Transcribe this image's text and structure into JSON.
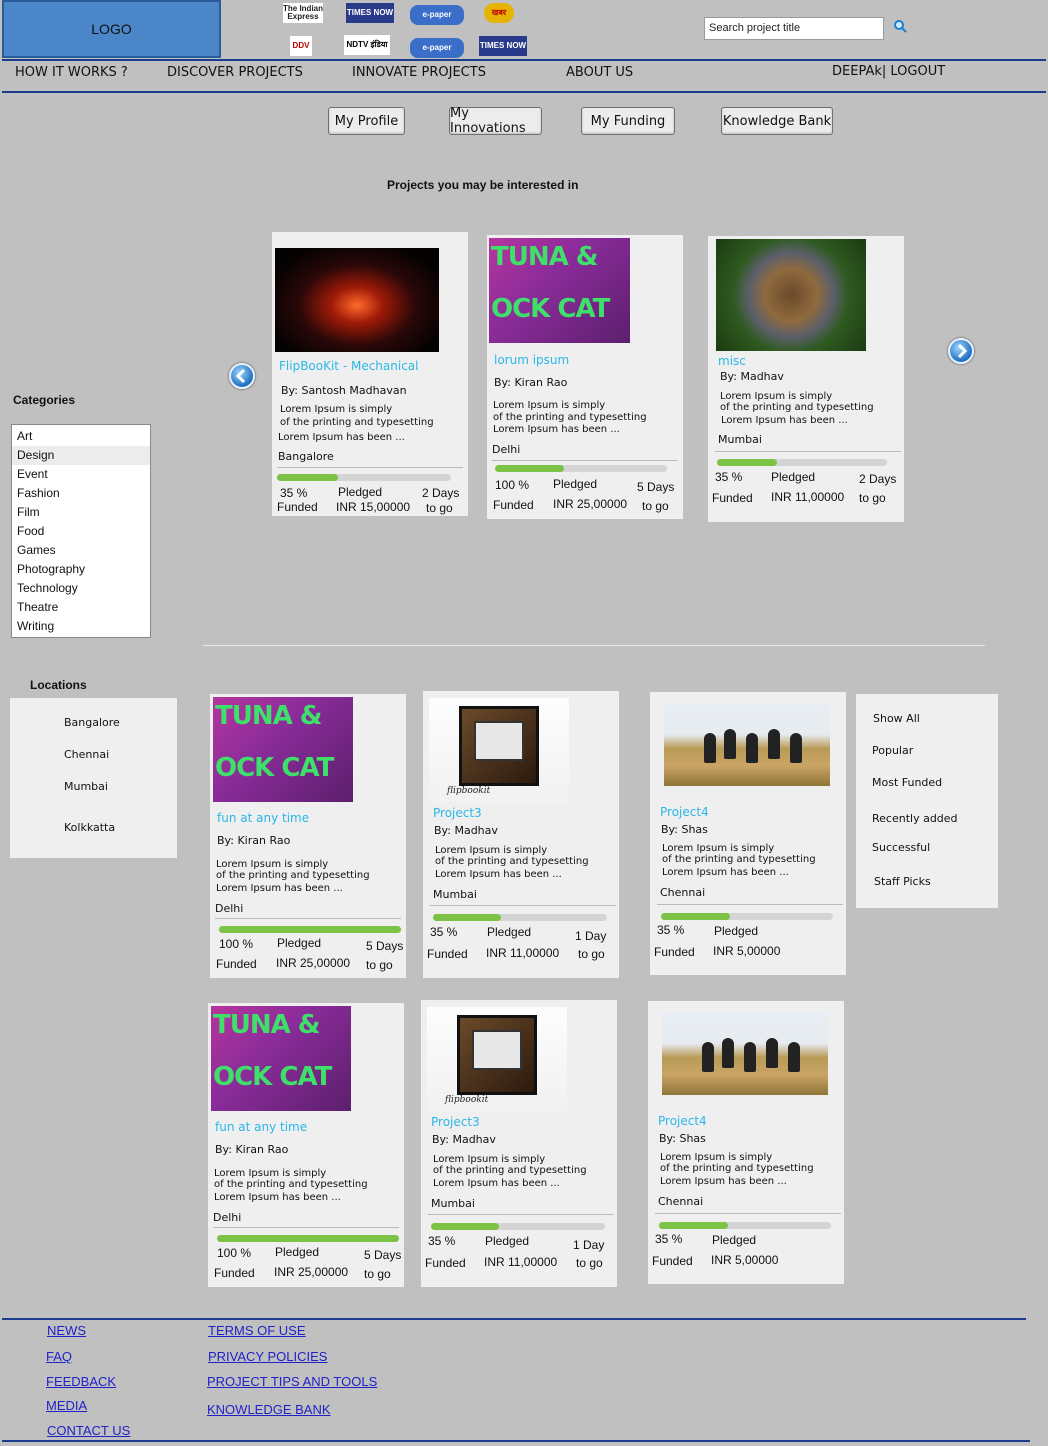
{
  "header": {
    "logo": "LOGO",
    "media_logos": [
      {
        "name": "newspaper-logo",
        "text": "The Indian Express",
        "bg": "#ffffff",
        "fg": "#222222"
      },
      {
        "name": "times-now-logo",
        "text": "TIMES NOW",
        "bg": "#2a3a8a",
        "fg": "#ffffff"
      },
      {
        "name": "epaper-logo",
        "text": "e-paper",
        "bg": "#3a6ec8",
        "fg": "#ffffff"
      },
      {
        "name": "tv-logo",
        "text": "खबर",
        "bg": "#e5b400",
        "fg": "#c00000"
      },
      {
        "name": "ddv-logo",
        "text": "DDV",
        "bg": "#ffffff",
        "fg": "#c00000"
      },
      {
        "name": "ndtv-india-logo",
        "text": "NDTV इंडिया",
        "bg": "#ffffff",
        "fg": "#000000"
      },
      {
        "name": "epaper-logo-2",
        "text": "e-paper",
        "bg": "#3a6ec8",
        "fg": "#ffffff"
      },
      {
        "name": "times-now-logo-2",
        "text": "TIMES NOW",
        "bg": "#2a3a8a",
        "fg": "#ffffff"
      }
    ],
    "search_placeholder": "Search project title"
  },
  "nav": {
    "how_it_works": "HOW IT WORKS ?",
    "discover": "DISCOVER PROJECTS",
    "innovate": "INNOVATE PROJECTS",
    "about": "ABOUT US",
    "user": "DEEPAk| LOGOUT"
  },
  "tabs": [
    "My Profile",
    "My Innovations",
    "My Funding",
    "Knowledge Bank"
  ],
  "section_title": "Projects you may be interested in",
  "categories": {
    "label": "Categories",
    "items": [
      "Art",
      "Design",
      "Event",
      "Fashion",
      "Film",
      "Food",
      "Games",
      "Photography",
      "Technology",
      "Theatre",
      "Writing"
    ],
    "selected": "Design"
  },
  "featured": [
    {
      "title": "FlipBooKit - Mechanical",
      "by": "By: Santosh Madhavan",
      "desc1": "Lorem Ipsum is simply",
      "desc2": "of the printing and typesetting",
      "desc3": "Lorem Ipsum has been ...",
      "location": "Bangalore",
      "funded_pct": "35 %",
      "funded_lbl": "Funded",
      "pledged_lbl": "Pledged",
      "pledged_amt": "INR 15,00000",
      "days": "2 Days",
      "days_lbl": "to go",
      "progress": 0.35
    },
    {
      "title": "lorum ipsum",
      "by": "By: Kiran Rao",
      "desc1": "Lorem Ipsum is simply",
      "desc2": "of the printing and typesetting",
      "desc3": "Lorem Ipsum has been ...",
      "location": "Delhi",
      "funded_pct": "100 %",
      "funded_lbl": "Funded",
      "pledged_lbl": "Pledged",
      "pledged_amt": "INR 25,00000",
      "days": "5 Days",
      "days_lbl": "to go",
      "progress": 0.4
    },
    {
      "title": "misc",
      "by": "By: Madhav",
      "desc1": "Lorem Ipsum is simply",
      "desc2": "of the printing and typesetting",
      "desc3": "Lorem Ipsum has been ...",
      "location": "Mumbai",
      "funded_pct": "35 %",
      "funded_lbl": "Funded",
      "pledged_lbl": "Pledged",
      "pledged_amt": "INR 11,00000",
      "days": "2 Days",
      "days_lbl": "to go",
      "progress": 0.35
    }
  ],
  "locations": {
    "label": "Locations",
    "items": [
      "Bangalore",
      "Chennai",
      "Mumbai",
      "Kolkkatta"
    ]
  },
  "filters": [
    "Show All",
    "Popular",
    "Most Funded",
    "Recently added",
    "Successful",
    "Staff Picks"
  ],
  "grid": [
    {
      "title": "fun at any time",
      "by": "By: Kiran Rao",
      "desc1": "Lorem Ipsum is simply",
      "desc2": "of the printing and typesetting",
      "desc3": "Lorem Ipsum has been ...",
      "location": "Delhi",
      "funded_pct": "100 %",
      "funded_lbl": "Funded",
      "pledged_lbl": "Pledged",
      "pledged_amt": "INR 25,00000",
      "days": "5 Days",
      "days_lbl": "to go",
      "progress": 1.0
    },
    {
      "title": "Project3",
      "by": "By: Madhav",
      "desc1": "Lorem Ipsum is simply",
      "desc2": "of the printing and typesetting",
      "desc3": "Lorem Ipsum has been ...",
      "location": "Mumbai",
      "funded_pct": "35 %",
      "funded_lbl": "Funded",
      "pledged_lbl": "Pledged",
      "pledged_amt": "INR 11,00000",
      "days": "1 Day",
      "days_lbl": "to go",
      "progress": 0.39
    },
    {
      "title": "Project4",
      "by": "By: Shas",
      "desc1": "Lorem Ipsum is simply",
      "desc2": "of the printing and typesetting",
      "desc3": "Lorem Ipsum has been ...",
      "location": "Chennai",
      "funded_pct": "35 %",
      "funded_lbl": "Funded",
      "pledged_lbl": "Pledged",
      "pledged_amt": "INR 5,00000",
      "days": "",
      "days_lbl": "",
      "progress": 0.4
    },
    {
      "title": "fun at any time",
      "by": "By: Kiran Rao",
      "desc1": "Lorem Ipsum is simply",
      "desc2": "of the printing and typesetting",
      "desc3": "Lorem Ipsum has been ...",
      "location": "Delhi",
      "funded_pct": "100 %",
      "funded_lbl": "Funded",
      "pledged_lbl": "Pledged",
      "pledged_amt": "INR 25,00000",
      "days": "5 Days",
      "days_lbl": "to go",
      "progress": 1.0
    },
    {
      "title": "Project3",
      "by": "By: Madhav",
      "desc1": "Lorem Ipsum is simply",
      "desc2": "of the printing and typesetting",
      "desc3": "Lorem Ipsum has been ...",
      "location": "Mumbai",
      "funded_pct": "35 %",
      "funded_lbl": "Funded",
      "pledged_lbl": "Pledged",
      "pledged_amt": "INR 11,00000",
      "days": "1 Day",
      "days_lbl": "to go",
      "progress": 0.39
    },
    {
      "title": "Project4",
      "by": "By: Shas",
      "desc1": "Lorem Ipsum is simply",
      "desc2": "of the printing and typesetting",
      "desc3": "Lorem Ipsum has been ...",
      "location": "Chennai",
      "funded_pct": "35 %",
      "funded_lbl": "Funded",
      "pledged_lbl": "Pledged",
      "pledged_amt": "INR 5,00000",
      "days": "",
      "days_lbl": "",
      "progress": 0.4
    }
  ],
  "footer": {
    "col1": [
      "NEWS",
      "FAQ",
      "FEEDBACK",
      "MEDIA",
      "CONTACT US"
    ],
    "col2": [
      "TERMS OF USE",
      "PRIVACY POLICIES",
      "PROJECT TIPS AND TOOLS",
      "KNOWLEDGE BANK"
    ]
  },
  "colors": {
    "accent_title": "#2ab7e8",
    "progress": "#7cc244",
    "rule": "#1c3d8c",
    "link": "#2121c8"
  }
}
